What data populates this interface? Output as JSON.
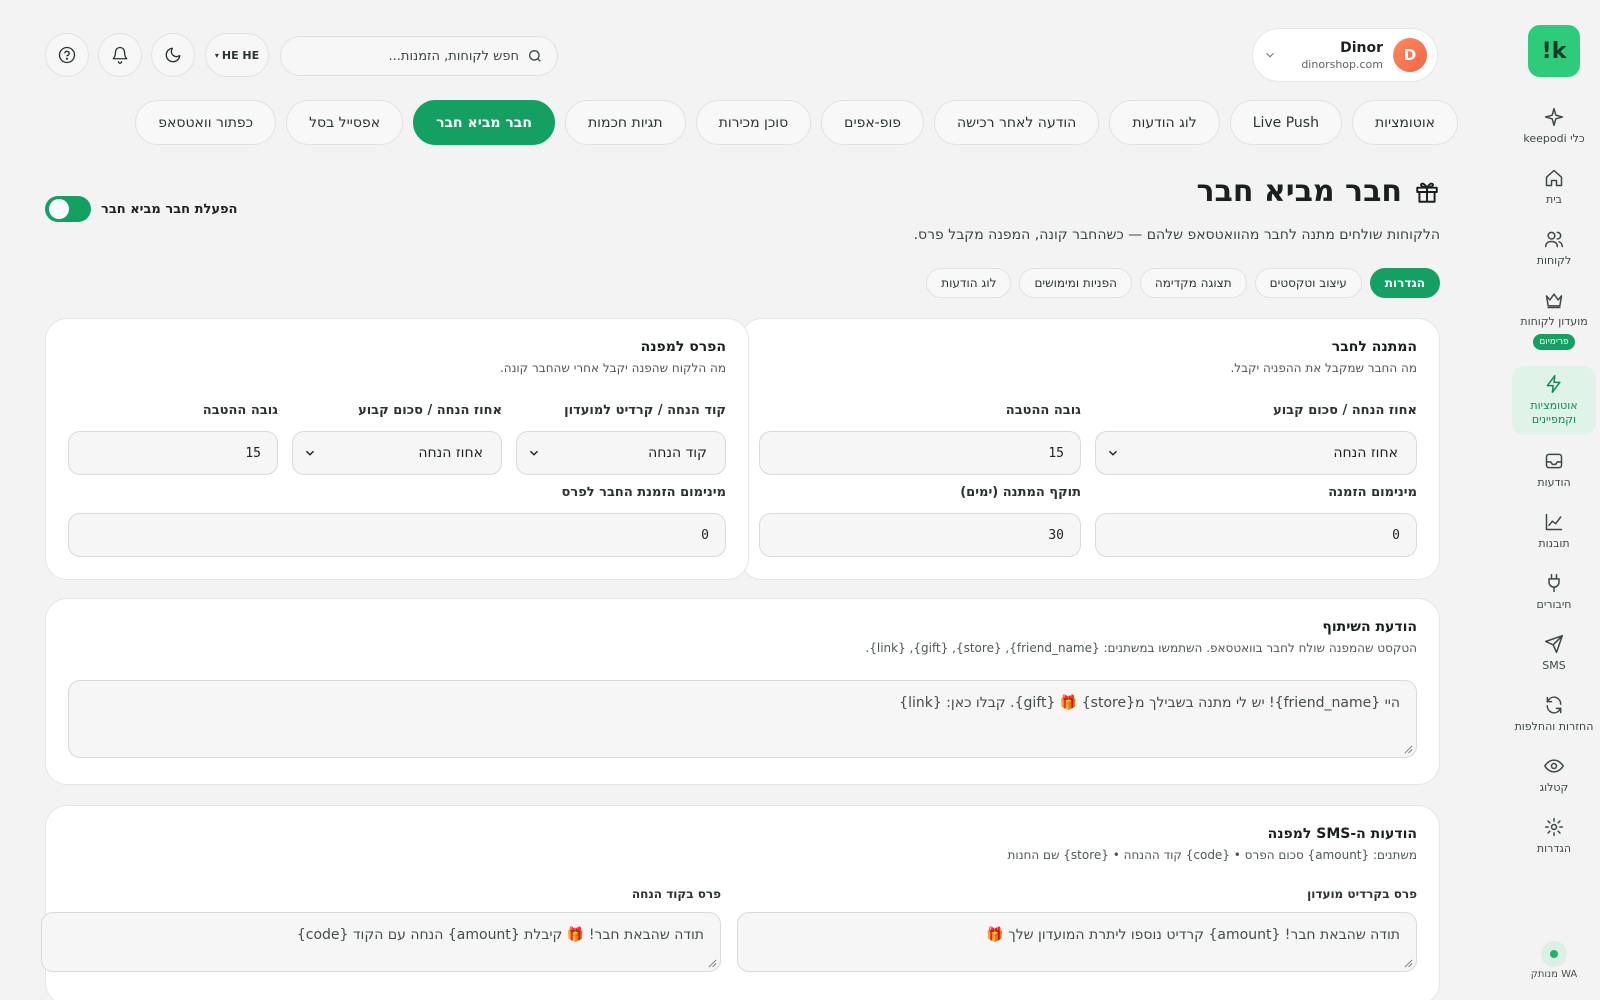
{
  "sidebar": {
    "logo": "!k",
    "items": [
      {
        "label": "כלי keepodi",
        "icon": "sparkle-icon"
      },
      {
        "label": "בית",
        "icon": "home-icon"
      },
      {
        "label": "לקוחות",
        "icon": "users-icon"
      },
      {
        "label": "מועדון לקוחות",
        "icon": "crown-icon",
        "badge": "פרימיום"
      },
      {
        "label": "אוטומציות וקמפיינים",
        "icon": "bolt-icon",
        "active": true
      },
      {
        "label": "הודעות",
        "icon": "inbox-icon"
      },
      {
        "label": "תובנות",
        "icon": "chart-icon"
      },
      {
        "label": "חיבורים",
        "icon": "plug-icon"
      },
      {
        "label": "SMS",
        "icon": "send-icon"
      },
      {
        "label": "החזרות והחלפות",
        "icon": "refresh-icon"
      },
      {
        "label": "קטלוג",
        "icon": "eye-icon"
      },
      {
        "label": "הגדרות",
        "icon": "gear-icon"
      }
    ],
    "wa_status": "WA מנותק"
  },
  "user": {
    "initial": "D",
    "name": "Dinor",
    "shop": "dinorshop.com"
  },
  "search": {
    "placeholder": "חפש לקוחות, הזמנות..."
  },
  "lang": "HE HE",
  "main_tabs": [
    "אוטומציות",
    "Live Push",
    "לוג הודעות",
    "הודעה לאחר רכישה",
    "פופ-אפים",
    "סוכן מכירות",
    "תגיות חכמות",
    "חבר מביא חבר",
    "אפסייל בסל",
    "כפתור וואטסאפ"
  ],
  "main_tab_active": 7,
  "page": {
    "title": "חבר מביא חבר",
    "description": "הלקוחות שולחים מתנה לחבר מהוואטסאפ שלהם — כשהחבר קונה, המפנה מקבל פרס.",
    "toggle_label": "הפעלת חבר מביא חבר",
    "toggle_on": true
  },
  "sub_tabs": [
    "הגדרות",
    "עיצוב וטקסטים",
    "תצוגה מקדימה",
    "הפניות ומימושים",
    "לוג הודעות"
  ],
  "friend_gift": {
    "title": "המתנה לחבר",
    "subtitle": "מה החבר שמקבל את ההפניה יקבל.",
    "type_label": "אחוז הנחה / סכום קבוע",
    "type_value": "אחוז הנחה",
    "amount_label": "גובה ההטבה",
    "amount_value": "15",
    "min_order_label": "מינימום הזמנה",
    "min_order_value": "0",
    "validity_label": "תוקף המתנה (ימים)",
    "validity_value": "30"
  },
  "referrer_reward": {
    "title": "הפרס למפנה",
    "subtitle": "מה הלקוח שהפנה יקבל אחרי שהחבר קונה.",
    "kind_label": "קוד הנחה / קרדיט למועדון",
    "kind_value": "קוד הנחה",
    "type_label": "אחוז הנחה / סכום קבוע",
    "type_value": "אחוז הנחה",
    "amount_label": "גובה ההטבה",
    "amount_value": "15",
    "min_order_label": "מינימום הזמנת החבר לפרס",
    "min_order_value": "0"
  },
  "share_message": {
    "title": "הודעת השיתוף",
    "subtitle": "הטקסט שהמפנה שולח לחבר בוואטסאפ. השתמשו במשתנים: {friend_name}, {store}, {gift}, {link}.",
    "text": "היי {friend_name}! יש לי מתנה בשבילך מ{store} 🎁 {gift}. קבלו כאן: {link}"
  },
  "sms": {
    "title": "הודעות ה-SMS למפנה",
    "subtitle": "משתנים: {amount} סכום הפרס • {code} קוד ההנחה • {store} שם החנות",
    "credit_label": "פרס בקרדיט מועדון",
    "credit_text": "תודה שהבאת חבר! {amount} קרדיט נוספו ליתרת המועדון שלך 🎁",
    "code_label": "פרס בקוד הנחה",
    "code_text": "תודה שהבאת חבר! 🎁 קיבלת {amount} הנחה עם הקוד {code}"
  },
  "colors": {
    "accent": "#14a063",
    "logo": "#2ecb7a",
    "background": "#f2f3f2"
  }
}
